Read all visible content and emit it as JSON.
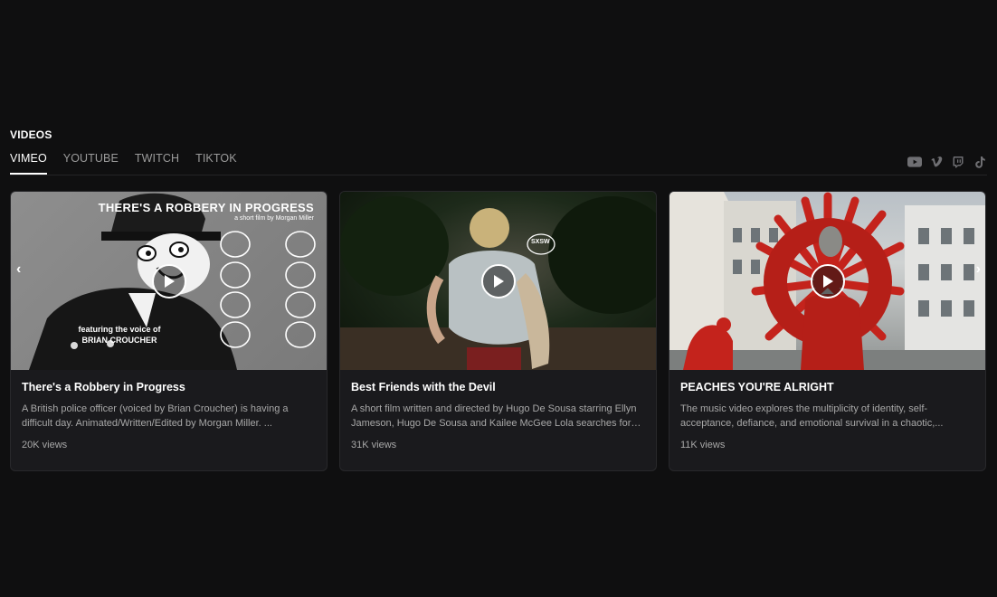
{
  "section": {
    "title": "VIDEOS"
  },
  "tabs": [
    {
      "label": "VIMEO",
      "active": true
    },
    {
      "label": "YOUTUBE",
      "active": false
    },
    {
      "label": "TWITCH",
      "active": false
    },
    {
      "label": "TIKTOK",
      "active": false
    }
  ],
  "social": [
    "youtube-icon",
    "vimeo-icon",
    "twitch-icon",
    "tiktok-icon"
  ],
  "carousel": {
    "prev": "‹",
    "next": "›"
  },
  "videos": [
    {
      "title": "There's a Robbery in Progress",
      "description": "A British police officer (voiced by Brian Croucher) is having a difficult day. Animated/Written/Edited by Morgan Miller. ...",
      "views": "20K views",
      "thumb_title": "THERE'S A ROBBERY IN PROGRESS",
      "thumb_subtitle": "a short film by Morgan Miller",
      "thumb_feature": "featuring the voice of BRIAN CROUCHER"
    },
    {
      "title": "Best Friends with the Devil",
      "description": "A short film written and directed by Hugo De Sousa starring Ellyn Jameson, Hugo De Sousa and Kailee McGee Lola searches for h...",
      "views": "31K views",
      "thumb_badge": "SXSW"
    },
    {
      "title": "PEACHES YOU'RE ALRIGHT",
      "description": "The music video explores the multiplicity of identity, self-acceptance, defiance, and emotional survival in a chaotic,...",
      "views": "11K views"
    }
  ]
}
